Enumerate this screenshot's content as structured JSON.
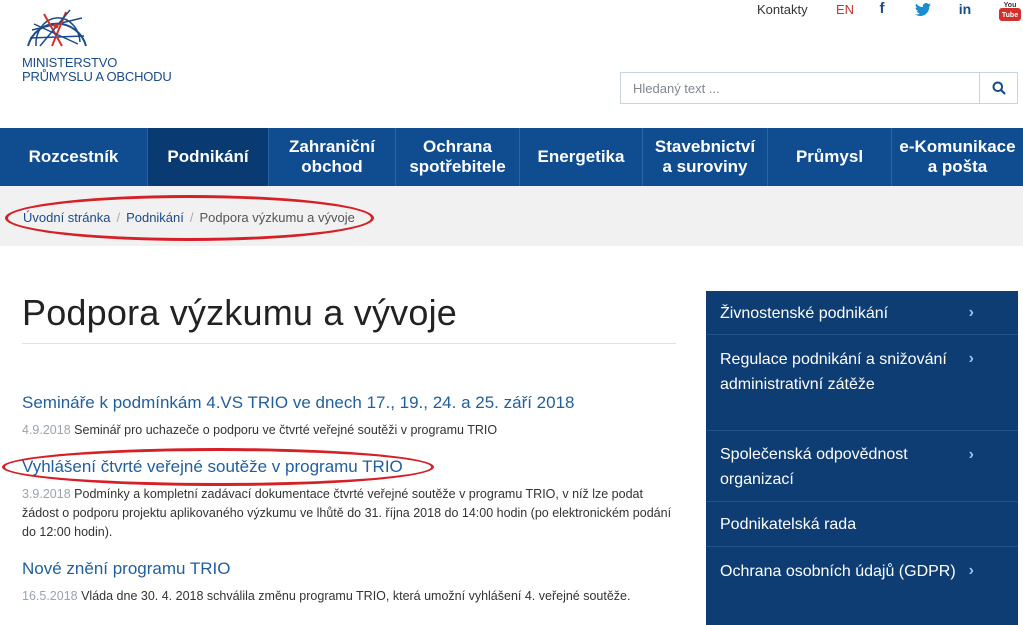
{
  "header": {
    "logo_line1": "MINISTERSTVO",
    "logo_line2": "PRŮMYSLU A OBCHODU",
    "top_links": {
      "contacts": "Kontakty",
      "lang": "EN"
    },
    "social": {
      "facebook": "f",
      "twitter": "twitter-icon",
      "linkedin": "in",
      "youtube_label": "You Tube"
    },
    "search": {
      "placeholder": "Hledaný text ..."
    }
  },
  "nav": {
    "items": [
      {
        "label": "Rozcestník"
      },
      {
        "label": "Podnikání"
      },
      {
        "label": "Zahraniční obchod"
      },
      {
        "label": "Ochrana spotřebitele"
      },
      {
        "label": "Energetika"
      },
      {
        "label": "Stavebnictví a suroviny"
      },
      {
        "label": "Průmysl"
      },
      {
        "label": "e-Komunikace a pošta"
      }
    ],
    "active_index": 1
  },
  "breadcrumb": {
    "items": [
      "Úvodní stránka",
      "Podnikání",
      "Podpora výzkumu a vývoje"
    ]
  },
  "main": {
    "title": "Podpora výzkumu a vývoje",
    "articles": [
      {
        "title": "Semináře k podmínkám 4.VS TRIO ve dnech 17., 19., 24. a 25. září 2018",
        "date": "4.9.2018",
        "text": "Seminář pro uchazeče o podporu ve čtvrté veřejné soutěži v programu TRIO"
      },
      {
        "title": "Vyhlášení čtvrté veřejné soutěže v programu TRIO",
        "date": "3.9.2018",
        "text": "Podmínky a kompletní zadávací dokumentace čtvrté veřejné soutěže v programu TRIO, v níž lze podat žádost o podporu projektu aplikovaného výzkumu ve lhůtě do 31. října 2018 do 14:00 hodin (po elektronickém podání do 12:00 hodin)."
      },
      {
        "title": "Nové znění programu TRIO",
        "date": "16.5.2018",
        "text": "Vláda dne 30. 4. 2018 schválila změnu programu TRIO, která umožní vyhlášení 4. veřejné soutěže."
      }
    ]
  },
  "sidebar": {
    "items": [
      {
        "label": "Živnostenské podnikání",
        "chevron": "›"
      },
      {
        "label": "Regulace podnikání a snižování administrativní zátěže",
        "chevron": "›"
      },
      {
        "label": "Společenská odpovědnost organizací",
        "chevron": "›"
      },
      {
        "label": "Podnikatelská rada",
        "chevron": ""
      },
      {
        "label": "Ochrana osobních údajů (GDPR)",
        "chevron": "›"
      }
    ]
  },
  "colors": {
    "nav_bg": "#0f4c90",
    "nav_active": "#0a3a72",
    "sidebar_bg": "#0d3d73",
    "link": "#1f5f9f",
    "annotation": "#d62027"
  }
}
